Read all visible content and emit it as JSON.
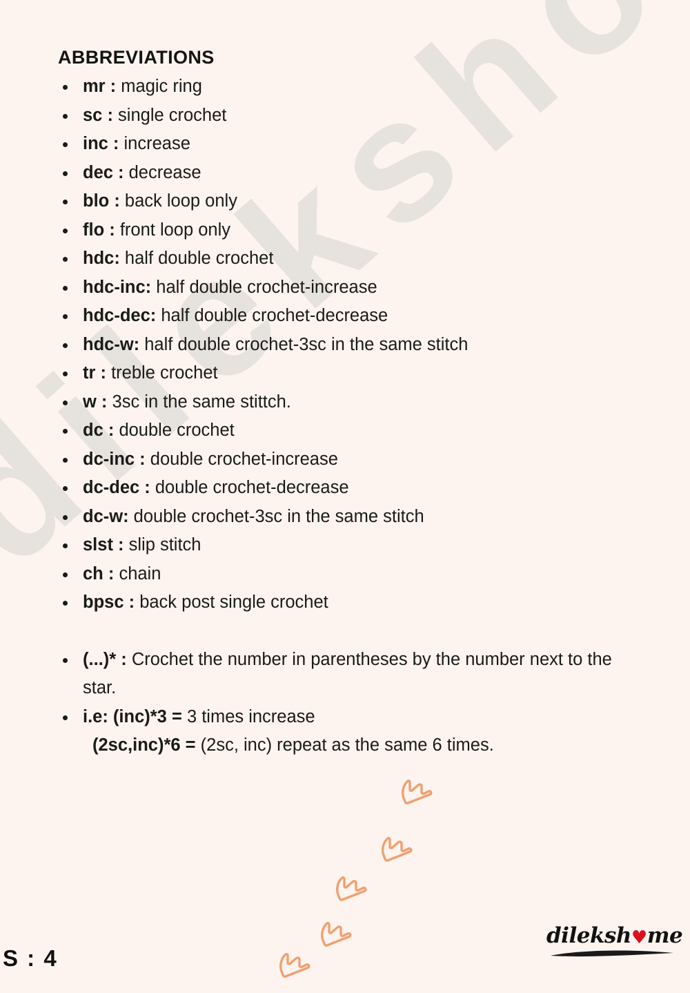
{
  "document": {
    "title": "ABBREVIATIONS",
    "page_number": "S : 4",
    "background_color": "#fdf4ef",
    "text_color": "#1a1a1a",
    "accent_color": "#f0a070",
    "watermark_text": "dilekshome",
    "watermark_color": "#e6e2dd"
  },
  "abbreviations": [
    {
      "term": "mr :",
      "definition": "magic ring"
    },
    {
      "term": "sc :",
      "definition": "single crochet"
    },
    {
      "term": "inc :",
      "definition": "increase"
    },
    {
      "term": "dec :",
      "definition": "decrease"
    },
    {
      "term": "blo :",
      "definition": "back loop only"
    },
    {
      "term": "flo :",
      "definition": "front loop only"
    },
    {
      "term": "hdc:",
      "definition": "half double crochet"
    },
    {
      "term": "hdc-inc:",
      "definition": "half double crochet-increase"
    },
    {
      "term": "hdc-dec:",
      "definition": "half double crochet-decrease"
    },
    {
      "term": "hdc-w:",
      "definition": "half double crochet-3sc in the same stitch"
    },
    {
      "term": "tr :",
      "definition": "treble crochet"
    },
    {
      "term": "w :",
      "definition": "3sc in the same stittch."
    },
    {
      "term": "dc :",
      "definition": "double crochet"
    },
    {
      "term": "dc-inc :",
      "definition": "double crochet-increase"
    },
    {
      "term": "dc-dec :",
      "definition": "double crochet-decrease"
    },
    {
      "term": "dc-w:",
      "definition": "double crochet-3sc in the same stitch"
    },
    {
      "term": "slst :",
      "definition": "slip stitch"
    },
    {
      "term": "ch :",
      "definition": "chain"
    },
    {
      "term": "bpsc :",
      "definition": "back post single crochet"
    }
  ],
  "notes": {
    "star_rule": {
      "term": "(...)* :",
      "definition": "Crochet the number in parentheses by the number next to the star."
    },
    "example_one": {
      "term": "i.e: (inc)*3 =",
      "definition": "3 times increase"
    },
    "example_two": {
      "term": "(2sc,inc)*6 =",
      "definition": "(2sc, inc) repeat as the same 6 times."
    }
  },
  "brand": {
    "name_before": "dileksh",
    "heart": "♥",
    "name_after": "me"
  },
  "decorations": {
    "arrow_icon_name": "bird-track-arrow-icon",
    "count": 5
  }
}
